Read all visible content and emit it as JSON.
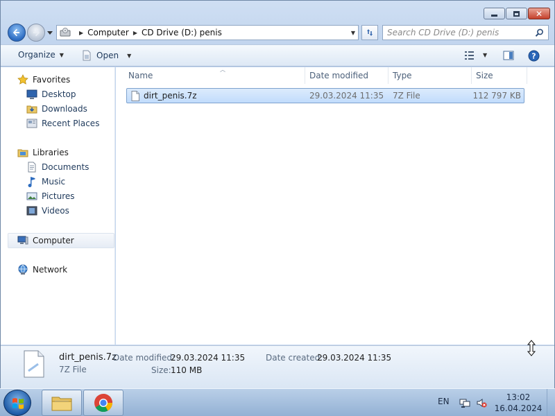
{
  "window": {
    "caption_buttons": [
      "minimize-icon",
      "maximize-icon",
      "close-icon"
    ]
  },
  "address_bar": {
    "crumbs": [
      "Computer",
      "CD Drive (D:) penis"
    ]
  },
  "search": {
    "placeholder": "Search CD Drive (D:) penis"
  },
  "toolbar": {
    "organize": "Organize",
    "open": "Open"
  },
  "nav": {
    "favorites": {
      "label": "Favorites",
      "items": [
        "Desktop",
        "Downloads",
        "Recent Places"
      ]
    },
    "libraries": {
      "label": "Libraries",
      "items": [
        "Documents",
        "Music",
        "Pictures",
        "Videos"
      ]
    },
    "computer": "Computer",
    "network": "Network"
  },
  "columns": {
    "name": "Name",
    "date_modified": "Date modified",
    "type": "Type",
    "size": "Size"
  },
  "files": [
    {
      "name": "dirt_penis.7z",
      "date_modified": "29.03.2024 11:35",
      "type": "7Z File",
      "size": "112 797 KB",
      "selected": true
    }
  ],
  "details": {
    "file_name": "dirt_penis.7z",
    "file_type": "7Z File",
    "date_modified_label": "Date modified:",
    "date_modified": "29.03.2024 11:35",
    "date_created_label": "Date created:",
    "date_created": "29.03.2024 11:35",
    "size_label": "Size:",
    "size": "110 MB"
  },
  "taskbar": {
    "language": "EN",
    "time": "13:02",
    "date": "16.04.2024"
  },
  "colors": {
    "accent": "#2c6cc2",
    "selection": "#c1dcfc",
    "link": "#1e395b"
  }
}
